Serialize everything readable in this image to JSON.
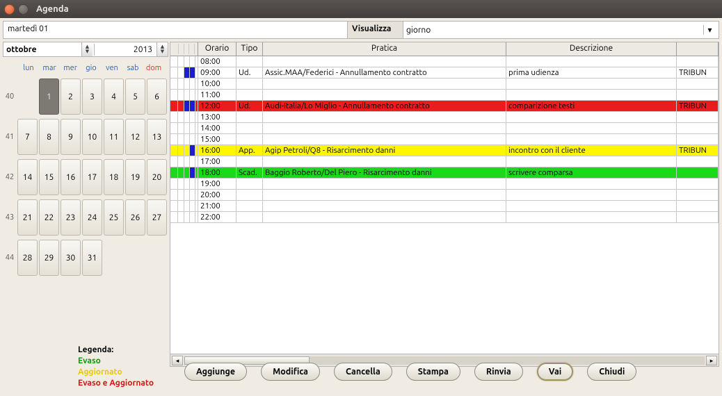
{
  "window": {
    "title": "Agenda"
  },
  "toprow": {
    "date": "martedì 01",
    "vis_label": "Visualizza",
    "vis_value": "giorno"
  },
  "monthbar": {
    "month": "ottobre",
    "year": "2013"
  },
  "dow": [
    "lun",
    "mar",
    "mer",
    "gio",
    "ven",
    "sab",
    "dom"
  ],
  "weeks": [
    {
      "wk": "40",
      "days": [
        "",
        "1",
        "2",
        "3",
        "4",
        "5",
        "6"
      ],
      "sel": 1
    },
    {
      "wk": "41",
      "days": [
        "7",
        "8",
        "9",
        "10",
        "11",
        "12",
        "13"
      ]
    },
    {
      "wk": "42",
      "days": [
        "14",
        "15",
        "16",
        "17",
        "18",
        "19",
        "20"
      ]
    },
    {
      "wk": "43",
      "days": [
        "21",
        "22",
        "23",
        "24",
        "25",
        "26",
        "27"
      ]
    },
    {
      "wk": "44",
      "days": [
        "28",
        "29",
        "30",
        "31",
        "",
        "",
        ""
      ]
    }
  ],
  "grid": {
    "headers": {
      "orario": "Orario",
      "tipo": "Tipo",
      "pratica": "Pratica",
      "descrizione": "Descrizione"
    },
    "rows": [
      {
        "flags": [
          "",
          ""
        ],
        "time": "08:00",
        "tipo": "",
        "prat": "",
        "desc": "",
        "last": ""
      },
      {
        "flags": [
          "blue",
          "blue"
        ],
        "time": "09:00",
        "tipo": "Ud.",
        "prat": "Assic.MAA/Federici - Annullamento contratto",
        "desc": "prima udienza",
        "last": "TRIBUN"
      },
      {
        "flags": [
          "",
          ""
        ],
        "time": "10:00"
      },
      {
        "flags": [
          "",
          ""
        ],
        "time": "11:00"
      },
      {
        "flags": [
          "blue",
          "blue"
        ],
        "time": "12:00",
        "tipo": "Ud.",
        "prat": "Audi-Italia/Lo Miglio - Annullamento contratto",
        "desc": "comparizione testi",
        "last": "TRIBUN",
        "cls": "row-red"
      },
      {
        "flags": [
          "",
          ""
        ],
        "time": "13:00"
      },
      {
        "flags": [
          "",
          ""
        ],
        "time": "14:00"
      },
      {
        "flags": [
          "",
          ""
        ],
        "time": "15:00"
      },
      {
        "flags": [
          "",
          "blue"
        ],
        "time": "16:00",
        "tipo": "App.",
        "prat": "Agip Petroli/Q8 - Risarcimento danni",
        "desc": "incontro con il cliente",
        "last": "TRIBUN",
        "cls": "row-yellow"
      },
      {
        "flags": [
          "",
          ""
        ],
        "time": "17:00"
      },
      {
        "flags": [
          "",
          "blue"
        ],
        "time": "18:00",
        "tipo": "Scad.",
        "prat": "Baggio Roberto/Del Piero - Risarcimento danni",
        "desc": "scrivere comparsa",
        "last": "",
        "cls": "row-green"
      },
      {
        "flags": [
          "",
          ""
        ],
        "time": "19:00"
      },
      {
        "flags": [
          "",
          ""
        ],
        "time": "20:00"
      },
      {
        "flags": [
          "",
          ""
        ],
        "time": "21:00"
      },
      {
        "flags": [
          "",
          ""
        ],
        "time": "22:00"
      }
    ]
  },
  "legend": {
    "title": "Legenda:",
    "evaso": "Evaso",
    "aggiornato": "Aggiornato",
    "evaso_agg": "Evaso e Aggiornato"
  },
  "buttons": {
    "add": "Aggiunge",
    "mod": "Modifica",
    "del": "Cancella",
    "print": "Stampa",
    "post": "Rinvia",
    "go": "Vai",
    "close": "Chiudi"
  }
}
